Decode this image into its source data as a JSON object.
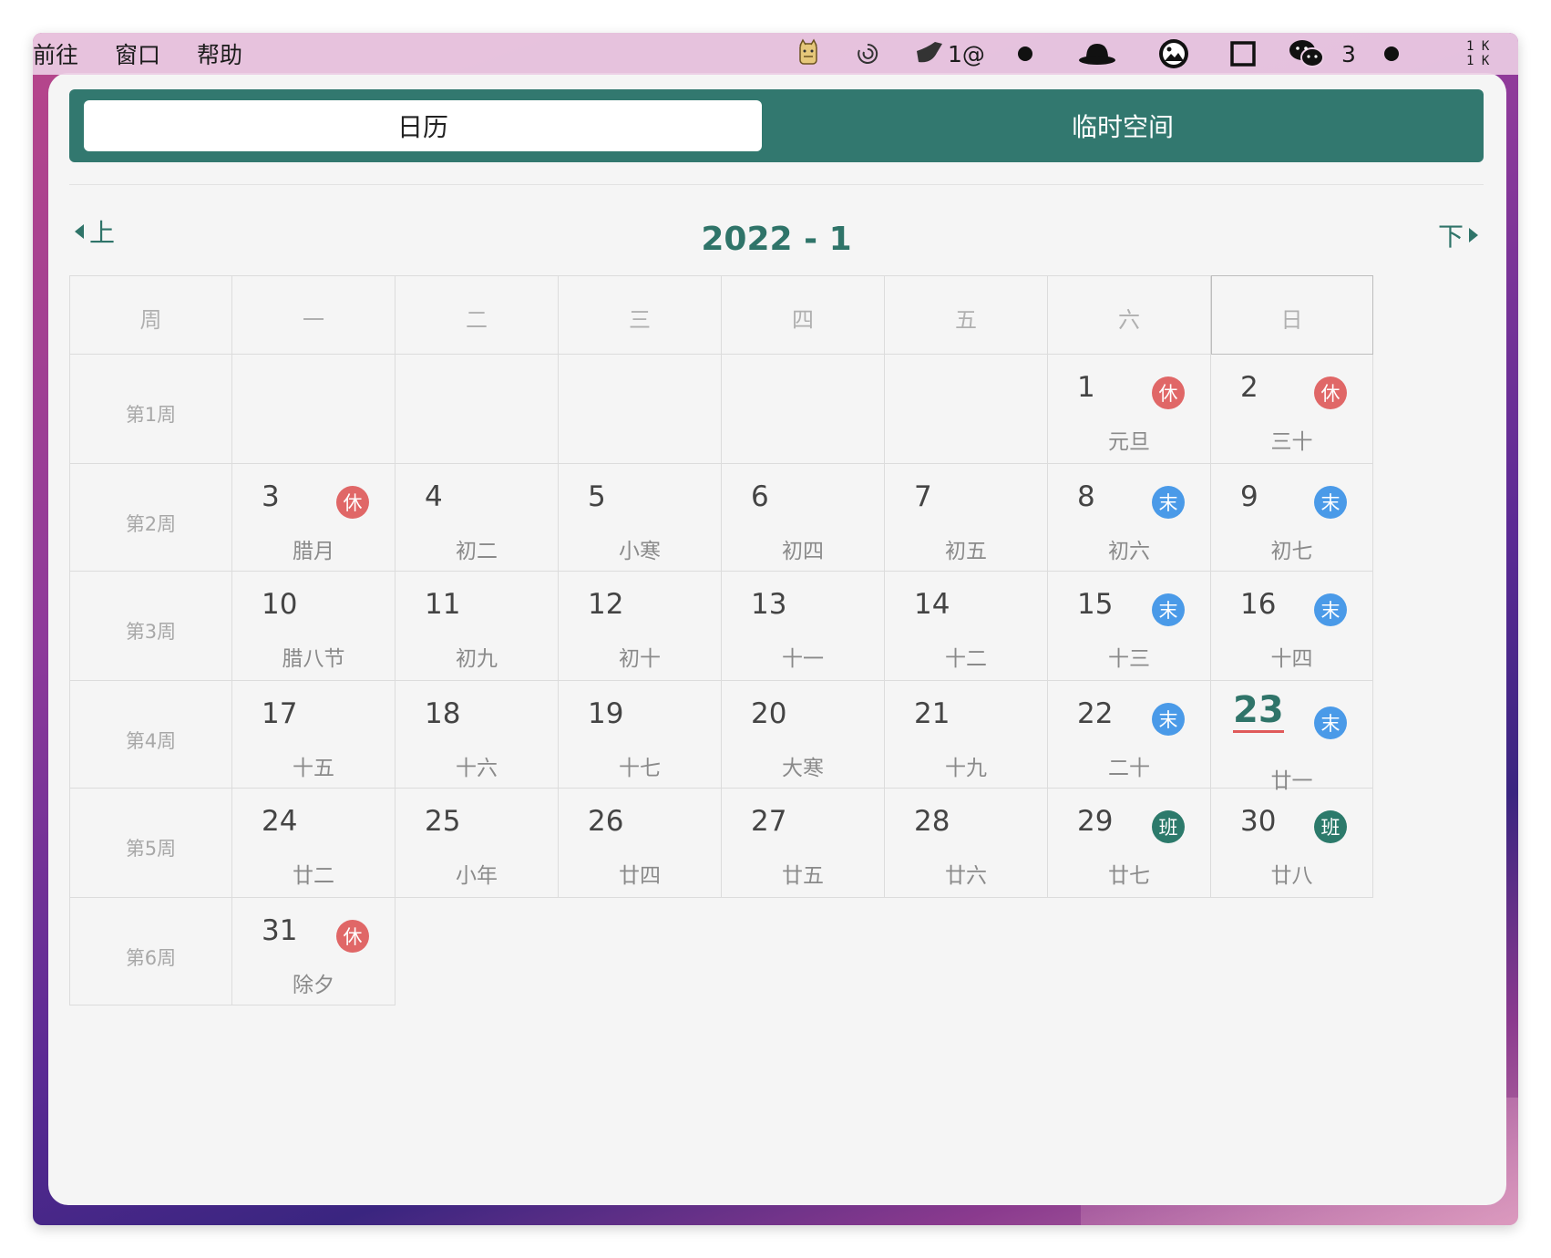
{
  "menubar": {
    "items": [
      "前往",
      "窗口",
      "帮助"
    ],
    "tray": {
      "notif_label": "1@",
      "wechat_count": "3",
      "net_up": "1 K",
      "net_down": "1 K"
    }
  },
  "tabs": {
    "calendar": "日历",
    "temp_space": "临时空间"
  },
  "nav": {
    "prev_label": "上",
    "next_label": "下",
    "month_title": "2022 - 1"
  },
  "calendar": {
    "header": [
      "周",
      "一",
      "二",
      "三",
      "四",
      "五",
      "六",
      "日"
    ],
    "weeks": [
      {
        "label": "第1周",
        "days": [
          null,
          null,
          null,
          null,
          null,
          {
            "num": "1",
            "lunar": "元旦",
            "badge": "休",
            "type": "rest"
          },
          {
            "num": "2",
            "lunar": "三十",
            "badge": "休",
            "type": "rest"
          }
        ]
      },
      {
        "label": "第2周",
        "days": [
          {
            "num": "3",
            "lunar": "腊月",
            "badge": "休",
            "type": "rest"
          },
          {
            "num": "4",
            "lunar": "初二"
          },
          {
            "num": "5",
            "lunar": "小寒"
          },
          {
            "num": "6",
            "lunar": "初四"
          },
          {
            "num": "7",
            "lunar": "初五"
          },
          {
            "num": "8",
            "lunar": "初六",
            "badge": "末",
            "type": "weekend"
          },
          {
            "num": "9",
            "lunar": "初七",
            "badge": "末",
            "type": "weekend"
          }
        ]
      },
      {
        "label": "第3周",
        "days": [
          {
            "num": "10",
            "lunar": "腊八节"
          },
          {
            "num": "11",
            "lunar": "初九"
          },
          {
            "num": "12",
            "lunar": "初十"
          },
          {
            "num": "13",
            "lunar": "十一"
          },
          {
            "num": "14",
            "lunar": "十二"
          },
          {
            "num": "15",
            "lunar": "十三",
            "badge": "末",
            "type": "weekend"
          },
          {
            "num": "16",
            "lunar": "十四",
            "badge": "末",
            "type": "weekend"
          }
        ]
      },
      {
        "label": "第4周",
        "days": [
          {
            "num": "17",
            "lunar": "十五"
          },
          {
            "num": "18",
            "lunar": "十六"
          },
          {
            "num": "19",
            "lunar": "十七"
          },
          {
            "num": "20",
            "lunar": "大寒"
          },
          {
            "num": "21",
            "lunar": "十九"
          },
          {
            "num": "22",
            "lunar": "二十",
            "badge": "末",
            "type": "weekend"
          },
          {
            "num": "23",
            "lunar": "廿一",
            "badge": "末",
            "type": "weekend",
            "today": true
          }
        ]
      },
      {
        "label": "第5周",
        "days": [
          {
            "num": "24",
            "lunar": "廿二"
          },
          {
            "num": "25",
            "lunar": "小年"
          },
          {
            "num": "26",
            "lunar": "廿四"
          },
          {
            "num": "27",
            "lunar": "廿五"
          },
          {
            "num": "28",
            "lunar": "廿六"
          },
          {
            "num": "29",
            "lunar": "廿七",
            "badge": "班",
            "type": "work"
          },
          {
            "num": "30",
            "lunar": "廿八",
            "badge": "班",
            "type": "work"
          }
        ]
      },
      {
        "label": "第6周",
        "days": [
          {
            "num": "31",
            "lunar": "除夕",
            "badge": "休",
            "type": "rest"
          },
          null,
          null,
          null,
          null,
          null,
          null
        ]
      }
    ]
  },
  "colors": {
    "accent": "#32786f",
    "rest_badge": "#e06767",
    "weekend_badge": "#4a9ae8",
    "work_badge": "#2c7a6b",
    "today_underline": "#e05a5a"
  }
}
